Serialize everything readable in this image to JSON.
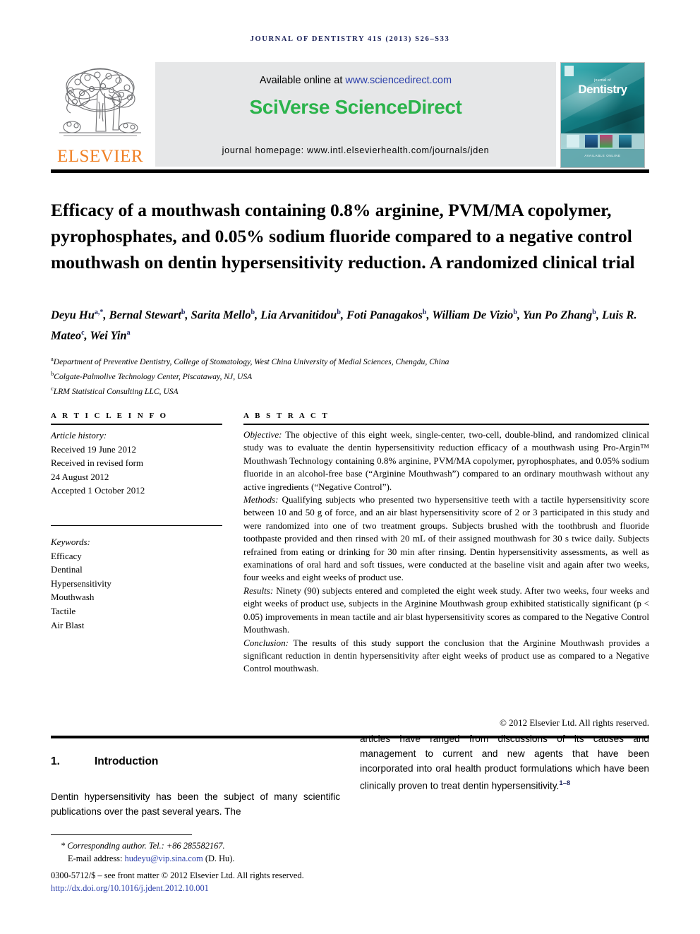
{
  "running_head": "JOURNAL OF DENTISTRY 41S (2013) S26–S33",
  "masthead": {
    "publisher_name": "ELSEVIER",
    "publisher_logo_icon": "elsevier-tree-logo",
    "available_prefix": "Available online at ",
    "available_link": "www.sciencedirect.com",
    "platform_title": "SciVerse ScienceDirect",
    "journal_homepage": "journal homepage: www.intl.elsevierhealth.com/journals/jden",
    "cover": {
      "kicker": "journal of",
      "title": "Dentistry",
      "footer_text": "AVAILABLE ONLINE"
    }
  },
  "article": {
    "title": "Efficacy of a mouthwash containing 0.8% arginine, PVM/MA copolymer, pyrophosphates, and 0.05% sodium fluoride compared to a negative control mouthwash on dentin hypersensitivity reduction. A randomized clinical trial",
    "authors_line_1": "Deyu Hu",
    "authors_html_note": "author names with superscript affiliation markers",
    "authors": [
      {
        "name": "Deyu Hu",
        "sup": "a,*"
      },
      {
        "name": "Bernal Stewart",
        "sup": "b"
      },
      {
        "name": "Sarita Mello",
        "sup": "b"
      },
      {
        "name": "Lia Arvanitidou",
        "sup": "b"
      },
      {
        "name": "Foti Panagakos",
        "sup": "b"
      },
      {
        "name": "William De Vizio",
        "sup": "b"
      },
      {
        "name": "Yun Po Zhang",
        "sup": "b"
      },
      {
        "name": "Luis R. Mateo",
        "sup": "c"
      },
      {
        "name": "Wei Yin",
        "sup": "a"
      }
    ],
    "affiliations": [
      {
        "marker": "a",
        "text": "Department of Preventive Dentistry, College of Stomatology, West China University of Medial Sciences, Chengdu, China"
      },
      {
        "marker": "b",
        "text": "Colgate-Palmolive Technology Center, Piscataway, NJ, USA"
      },
      {
        "marker": "c",
        "text": "LRM Statistical Consulting LLC, USA"
      }
    ]
  },
  "article_info": {
    "heading": "A R T I C L E    I N F O",
    "history_label": "Article history:",
    "history": [
      "Received 19 June 2012",
      "Received in revised form",
      "24 August 2012",
      "Accepted 1 October 2012"
    ],
    "keywords_label": "Keywords:",
    "keywords": [
      "Efficacy",
      "Dentinal",
      "Hypersensitivity",
      "Mouthwash",
      "Tactile",
      "Air Blast"
    ]
  },
  "abstract": {
    "heading": "A B S T R A C T",
    "objective_label": "Objective:",
    "objective_text": " The objective of this eight week, single-center, two-cell, double-blind, and randomized clinical study was to evaluate the dentin hypersensitivity reduction efficacy of a mouthwash using Pro-Argin™ Mouthwash Technology containing 0.8% arginine, PVM/MA copolymer, pyrophosphates, and 0.05% sodium fluoride in an alcohol-free base (“Arginine Mouthwash”) compared to an ordinary mouthwash without any active ingredients (“Negative Control”).",
    "methods_label": "Methods:",
    "methods_text": " Qualifying subjects who presented two hypersensitive teeth with a tactile hypersensitivity score between 10 and 50 g of force, and an air blast hypersensitivity score of 2 or 3 participated in this study and were randomized into one of two treatment groups. Subjects brushed with the toothbrush and fluoride toothpaste provided and then rinsed with 20 mL of their assigned mouthwash for 30 s twice daily. Subjects refrained from eating or drinking for 30 min after rinsing. Dentin hypersensitivity assessments, as well as examinations of oral hard and soft tissues, were conducted at the baseline visit and again after two weeks, four weeks and eight weeks of product use.",
    "results_label": "Results:",
    "results_text": " Ninety (90) subjects entered and completed the eight week study. After two weeks, four weeks and eight weeks of product use, subjects in the Arginine Mouthwash group exhibited statistically significant (p < 0.05) improvements in mean tactile and air blast hypersensitivity scores as compared to the Negative Control Mouthwash.",
    "conclusion_label": "Conclusion:",
    "conclusion_text": " The results of this study support the conclusion that the Arginine Mouthwash provides a significant reduction in dentin hypersensitivity after eight weeks of product use as compared to a Negative Control mouthwash.",
    "copyright": "© 2012 Elsevier Ltd. All rights reserved."
  },
  "body": {
    "section_number": "1.",
    "section_title": "Introduction",
    "left_paragraph": "Dentin hypersensitivity has been the subject of many scientific publications over the past several years. The",
    "right_paragraph": "articles have ranged from discussions of its causes and management to current and new agents that have been incorporated into oral health product formulations which have been clinically proven to treat dentin hypersensitivity.",
    "right_citation": "1–8"
  },
  "footer": {
    "corresponding_marker": "*",
    "corresponding_text": "Corresponding author. Tel.: +86 285582167.",
    "email_label": "E-mail address: ",
    "email": "hudeyu@vip.sina.com",
    "email_suffix": " (D. Hu).",
    "front_matter": "0300-5712/$ – see front matter © 2012 Elsevier Ltd. All rights reserved.",
    "doi": "http://dx.doi.org/10.1016/j.jdent.2012.10.001"
  },
  "colors": {
    "running_head": "#1a2159",
    "elsevier_orange": "#f08024",
    "sciencedirect_green": "#2bb34b",
    "link_blue": "#2b3faa",
    "banner_gray": "#e6e7e8"
  }
}
